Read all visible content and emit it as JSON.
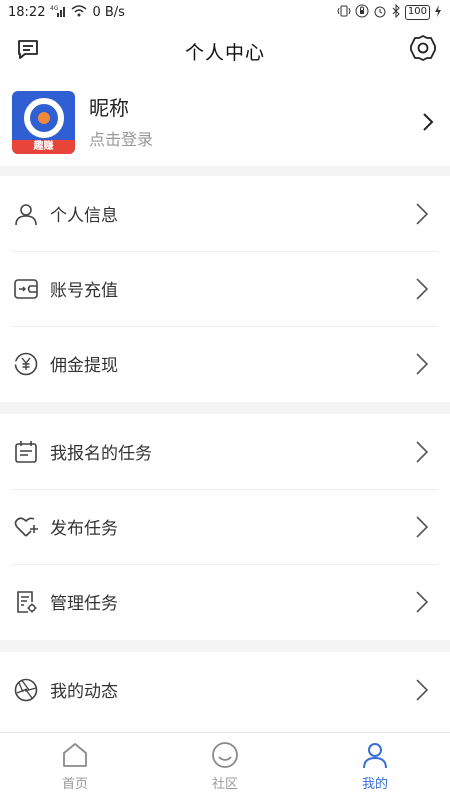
{
  "status_bar": {
    "time": "18:22",
    "network_speed": "0 B/s",
    "signal_type": "4G",
    "battery": "100"
  },
  "header": {
    "title": "个人中心",
    "message_icon": "message-icon",
    "settings_icon": "gear-icon"
  },
  "profile": {
    "nickname": "昵称",
    "login_hint": "点击登录",
    "avatar_badge": "趣赚"
  },
  "menu_sections": [
    {
      "items": [
        {
          "label": "个人信息",
          "icon": "person-icon"
        },
        {
          "label": "账号充值",
          "icon": "wallet-icon"
        },
        {
          "label": "佣金提现",
          "icon": "yen-icon"
        }
      ]
    },
    {
      "items": [
        {
          "label": "我报名的任务",
          "icon": "calendar-icon"
        },
        {
          "label": "发布任务",
          "icon": "heart-plus-icon"
        },
        {
          "label": "管理任务",
          "icon": "document-gear-icon"
        }
      ]
    },
    {
      "items": [
        {
          "label": "我的动态",
          "icon": "aperture-icon"
        }
      ]
    }
  ],
  "tab_bar": {
    "tabs": [
      {
        "label": "首页",
        "icon": "home-icon",
        "active": false
      },
      {
        "label": "社区",
        "icon": "smiley-icon",
        "active": false
      },
      {
        "label": "我的",
        "icon": "person-icon",
        "active": true
      }
    ]
  },
  "colors": {
    "accent": "#3a6fd8",
    "background": "#f4f4f4",
    "card": "#ffffff",
    "text_primary": "#333333",
    "text_secondary": "#999999"
  }
}
